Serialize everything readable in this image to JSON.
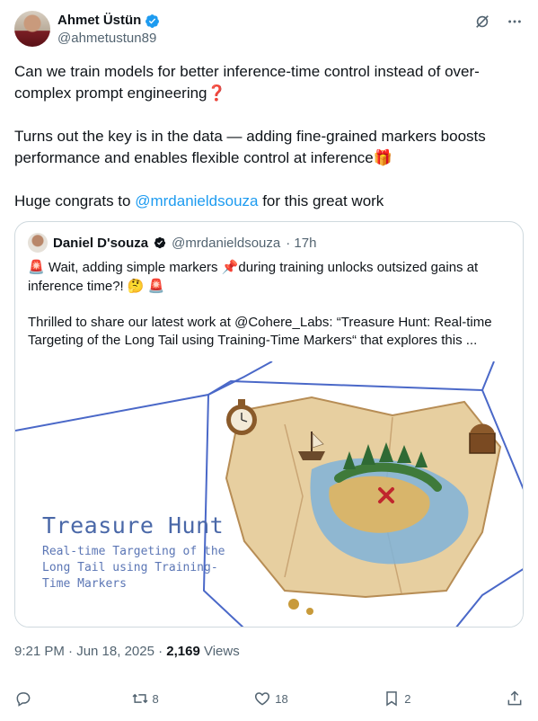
{
  "author": {
    "name": "Ahmet Üstün",
    "handle": "@ahmetustun89"
  },
  "tweet": {
    "line1": "Can we train models for better inference-time control instead of over-complex prompt engineering",
    "line1_emoji": "❓",
    "line2": "Turns out the key is in the data — adding fine-grained markers boosts performance and enables flexible control at inference",
    "line2_emoji": "🎁",
    "line3_prefix": "Huge congrats to ",
    "line3_mention": "@mrdanieldsouza",
    "line3_suffix": " for this great work"
  },
  "quote": {
    "name": "Daniel D'souza",
    "handle": "@mrdanieldsouza",
    "time": "· 17h",
    "para1_e1": "🚨",
    "para1_a": " Wait, adding simple markers ",
    "para1_e2": "📌",
    "para1_b": "during training unlocks outsized gains at inference time?! ",
    "para1_e3": "🤔",
    "para1_e4": "🚨",
    "para2": "Thrilled to share our latest work at @Cohere_Labs: “Treasure Hunt: Real-time Targeting of the Long Tail using Training-Time Markers“ that explores this ...",
    "media_title": "Treasure Hunt",
    "media_subtitle": "Real-time Targeting of the Long Tail using Training-Time Markers"
  },
  "meta": {
    "time": "9:21 PM · Jun 18, 2025 · ",
    "views_count": "2,169",
    "views_label": " Views"
  },
  "actions": {
    "replies": "",
    "reposts": "8",
    "likes": "18",
    "bookmarks": "2"
  },
  "colors": {
    "accent": "#1d9bf0",
    "text": "#0f1419",
    "muted": "#536471",
    "border": "#cfd9de"
  }
}
